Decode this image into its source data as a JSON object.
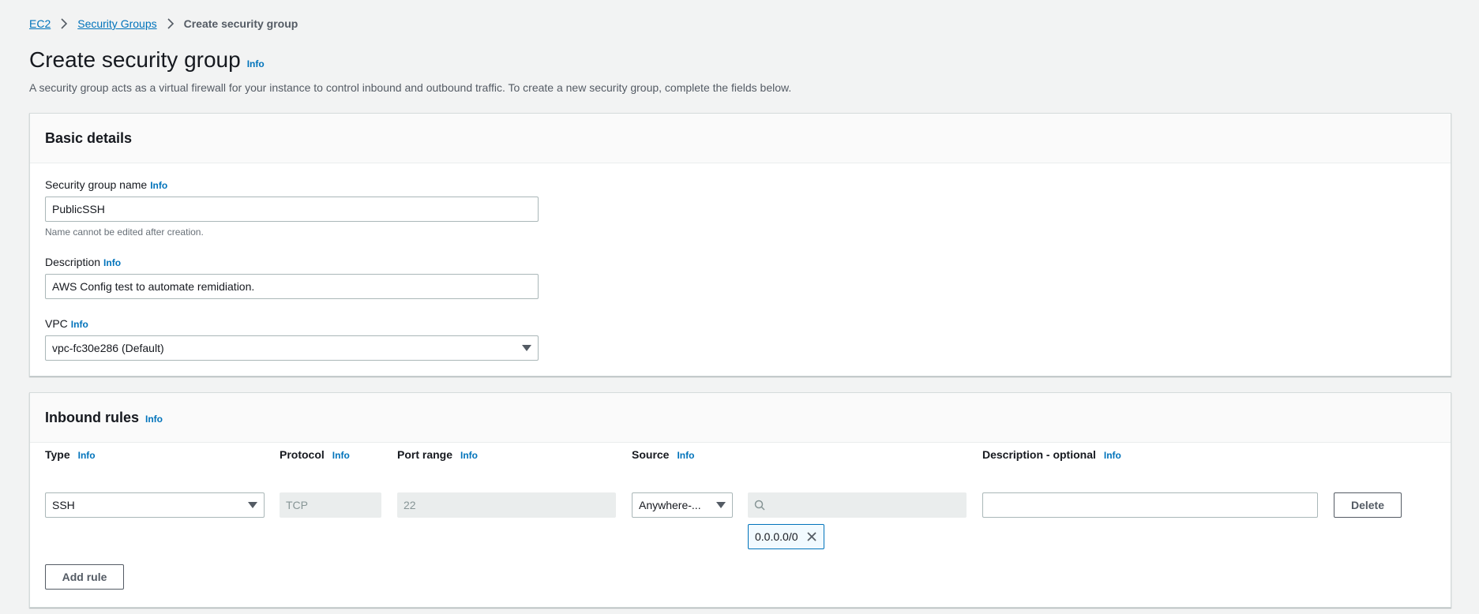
{
  "breadcrumb": {
    "ec2": "EC2",
    "security_groups": "Security Groups",
    "current": "Create security group"
  },
  "page": {
    "title": "Create security group",
    "info": "Info",
    "description": "A security group acts as a virtual firewall for your instance to control inbound and outbound traffic. To create a new security group, complete the fields below."
  },
  "basic": {
    "heading": "Basic details",
    "name_label": "Security group name",
    "name_value": "PublicSSH",
    "name_hint": "Name cannot be edited after creation.",
    "desc_label": "Description",
    "desc_value": "AWS Config test to automate remidiation.",
    "vpc_label": "VPC",
    "vpc_value": "vpc-fc30e286 (Default)",
    "info": "Info"
  },
  "inbound": {
    "heading": "Inbound rules",
    "info": "Info",
    "columns": {
      "type": "Type",
      "protocol": "Protocol",
      "port_range": "Port range",
      "source": "Source",
      "description": "Description - optional"
    },
    "rule": {
      "type": "SSH",
      "protocol": "TCP",
      "port_range": "22",
      "source": "Anywhere-...",
      "cidr": "0.0.0.0/0",
      "description": ""
    },
    "delete_label": "Delete",
    "add_rule_label": "Add rule"
  },
  "colors": {
    "link": "#0073bb",
    "background": "#f2f3f3",
    "border": "#aab7b8"
  }
}
